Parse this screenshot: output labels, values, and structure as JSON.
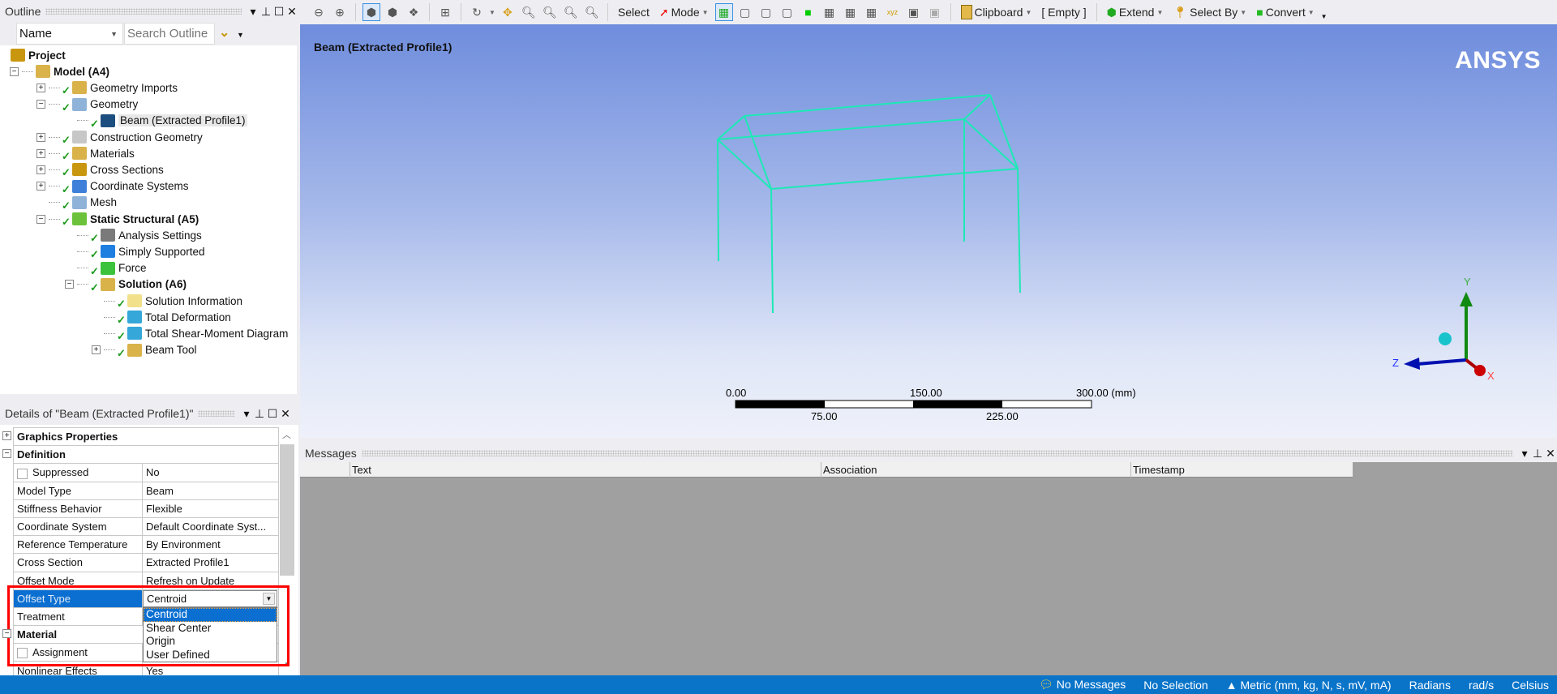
{
  "outline": {
    "title": "Outline",
    "filter_select": "Name",
    "search_placeholder": "Search Outline",
    "tree": [
      {
        "label": "Project",
        "bold": true,
        "level": 0,
        "exp": "",
        "icon": "project-icon",
        "color": "#c9970f"
      },
      {
        "label": "Model (A4)",
        "bold": true,
        "level": 1,
        "exp": "−",
        "icon": "model-icon",
        "color": "#d9b24a"
      },
      {
        "label": "Geometry Imports",
        "level": 2,
        "exp": "+",
        "icon": "geometry-imports-icon",
        "color": "#d9b24a"
      },
      {
        "label": "Geometry",
        "level": 2,
        "exp": "−",
        "icon": "geometry-icon",
        "color": "#8fb3d8"
      },
      {
        "label": "Beam (Extracted Profile1)",
        "level": 3,
        "exp": "",
        "icon": "beam-icon",
        "color": "#1d4e80",
        "selected": true
      },
      {
        "label": "Construction Geometry",
        "level": 2,
        "exp": "+",
        "icon": "construction-geometry-icon",
        "color": "#c7c7c7"
      },
      {
        "label": "Materials",
        "level": 2,
        "exp": "+",
        "icon": "materials-icon",
        "color": "#d9b24a"
      },
      {
        "label": "Cross Sections",
        "level": 2,
        "exp": "+",
        "icon": "cross-sections-icon",
        "color": "#c9970f"
      },
      {
        "label": "Coordinate Systems",
        "level": 2,
        "exp": "+",
        "icon": "coordinate-systems-icon",
        "color": "#3d7fd9"
      },
      {
        "label": "Mesh",
        "level": 2,
        "exp": "",
        "icon": "mesh-icon",
        "color": "#8fb3d8"
      },
      {
        "label": "Static Structural (A5)",
        "bold": true,
        "level": 2,
        "exp": "−",
        "icon": "static-structural-icon",
        "color": "#6cc33b"
      },
      {
        "label": "Analysis Settings",
        "level": 3,
        "exp": "",
        "icon": "analysis-settings-icon",
        "color": "#7a7a7a"
      },
      {
        "label": "Simply Supported",
        "level": 3,
        "exp": "",
        "icon": "simply-supported-icon",
        "color": "#1e7fe0"
      },
      {
        "label": "Force",
        "level": 3,
        "exp": "",
        "icon": "force-icon",
        "color": "#3cc23c"
      },
      {
        "label": "Solution (A6)",
        "bold": true,
        "level": 3,
        "exp": "−",
        "icon": "solution-icon",
        "color": "#d9b24a"
      },
      {
        "label": "Solution Information",
        "level": 4,
        "exp": "",
        "icon": "solution-information-icon",
        "color": "#f2e08a"
      },
      {
        "label": "Total Deformation",
        "level": 4,
        "exp": "",
        "icon": "total-deformation-icon",
        "color": "#35a7d8"
      },
      {
        "label": "Total Shear-Moment Diagram",
        "level": 4,
        "exp": "",
        "icon": "shear-moment-icon",
        "color": "#35a7d8"
      },
      {
        "label": "Beam Tool",
        "level": 4,
        "exp": "+",
        "icon": "beam-tool-icon",
        "color": "#d9b24a"
      }
    ]
  },
  "details": {
    "title": "Details of \"Beam (Extracted Profile1)\"",
    "rows": [
      {
        "type": "group",
        "exp": "+",
        "label": "Graphics Properties"
      },
      {
        "type": "group",
        "exp": "−",
        "label": "Definition"
      },
      {
        "label": "Suppressed",
        "value": "No",
        "checkbox": true
      },
      {
        "label": "Model Type",
        "value": "Beam"
      },
      {
        "label": "Stiffness Behavior",
        "value": "Flexible"
      },
      {
        "label": "Coordinate System",
        "value": "Default Coordinate Syst..."
      },
      {
        "label": "Reference Temperature",
        "value": "By Environment"
      },
      {
        "label": "Cross Section",
        "value": "Extracted Profile1"
      },
      {
        "label": "Offset Mode",
        "value": "Refresh on Update"
      },
      {
        "label": "Offset Type",
        "value": "Centroid",
        "selected": true
      },
      {
        "label": "Treatment",
        "value": ""
      },
      {
        "type": "group",
        "exp": "−",
        "label": "Material"
      },
      {
        "label": "Assignment",
        "value": "",
        "checkbox": true
      },
      {
        "label": "Nonlinear Effects",
        "value": "Yes"
      }
    ],
    "dropdown_options": [
      "Centroid",
      "Shear Center",
      "Origin",
      "User Defined"
    ],
    "dropdown_selected": "Centroid"
  },
  "toolbar": {
    "select": "Select",
    "mode": "Mode",
    "clipboard": "Clipboard",
    "clipboard_state": "[ Empty ]",
    "extend": "Extend",
    "select_by": "Select By",
    "convert": "Convert"
  },
  "viewport": {
    "title": "Beam (Extracted Profile1)",
    "logo": "ANSYS",
    "scale": {
      "top": [
        "0.00",
        "150.00",
        "300.00 (mm)"
      ],
      "bottom": [
        "75.00",
        "225.00"
      ]
    },
    "axes": {
      "x": "X",
      "y": "Y",
      "z": "Z"
    },
    "beam_color": "#1de9b6"
  },
  "messages": {
    "title": "Messages",
    "columns": [
      "Text",
      "Association",
      "Timestamp"
    ]
  },
  "status": {
    "messages": "No Messages",
    "selection": "No Selection",
    "units": "Metric (mm, kg, N, s, mV, mA)",
    "angle": "Radians",
    "rot_velocity": "rad/s",
    "temperature": "Celsius"
  }
}
